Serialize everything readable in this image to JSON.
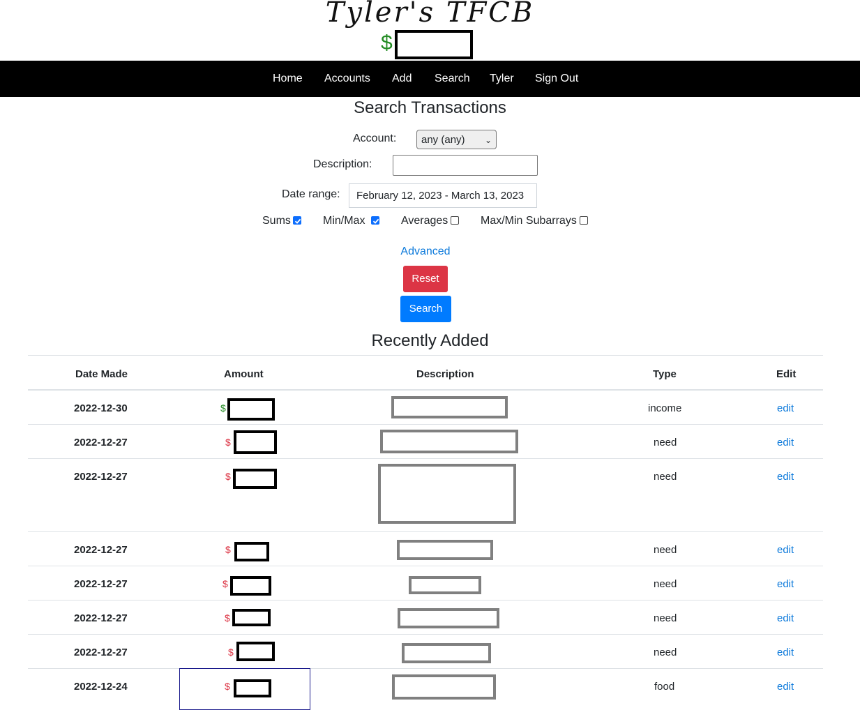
{
  "header": {
    "site_title": "Tyler's TFCB",
    "balance_currency": "$"
  },
  "nav": {
    "items": [
      {
        "label": "Home"
      },
      {
        "label": "Accounts"
      },
      {
        "label": "Add"
      },
      {
        "label": "Search"
      },
      {
        "label": "Tyler"
      },
      {
        "label": "Sign Out"
      }
    ]
  },
  "search": {
    "title": "Search Transactions",
    "account_label": "Account:",
    "account_value": "any (any)",
    "description_label": "Description:",
    "description_value": "",
    "date_range_label": "Date range:",
    "date_range_value": "February 12, 2023 - March 13, 2023",
    "options": [
      {
        "label": "Sums",
        "checked": true
      },
      {
        "label": "Min/Max",
        "checked": true
      },
      {
        "label": "Averages",
        "checked": false
      },
      {
        "label": "Max/Min Subarrays",
        "checked": false
      }
    ],
    "advanced_link": "Advanced",
    "reset_label": "Reset",
    "search_label": "Search"
  },
  "recent": {
    "title": "Recently Added",
    "columns": [
      "Date Made",
      "Amount",
      "Description",
      "Type",
      "Edit"
    ],
    "rows": [
      {
        "date": "2022-12-30",
        "currency": "$",
        "type": "income",
        "edit": "edit",
        "amount_kind": "income"
      },
      {
        "date": "2022-12-27",
        "currency": "$",
        "type": "need",
        "edit": "edit",
        "amount_kind": "expense"
      },
      {
        "date": "2022-12-27",
        "currency": "$",
        "type": "need",
        "edit": "edit",
        "amount_kind": "expense"
      },
      {
        "date": "2022-12-27",
        "currency": "$",
        "type": "need",
        "edit": "edit",
        "amount_kind": "expense"
      },
      {
        "date": "2022-12-27",
        "currency": "$",
        "type": "need",
        "edit": "edit",
        "amount_kind": "expense"
      },
      {
        "date": "2022-12-27",
        "currency": "$",
        "type": "need",
        "edit": "edit",
        "amount_kind": "expense"
      },
      {
        "date": "2022-12-27",
        "currency": "$",
        "type": "need",
        "edit": "edit",
        "amount_kind": "expense"
      },
      {
        "date": "2022-12-24",
        "currency": "$",
        "type": "food",
        "edit": "edit",
        "amount_kind": "expense"
      }
    ]
  },
  "colors": {
    "navbar": "#000000",
    "income": "#228b22",
    "expense": "#dc3545",
    "link": "#0d7adb",
    "reset_button": "#dc3545",
    "search_button": "#007bff"
  }
}
